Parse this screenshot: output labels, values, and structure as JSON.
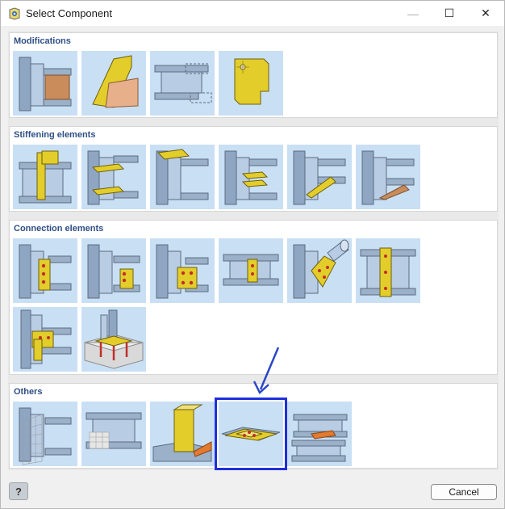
{
  "window": {
    "title": "Select Component",
    "minimize_glyph": "—",
    "maximize_glyph": "☐",
    "close_glyph": "✕"
  },
  "groups": [
    {
      "title": "Modifications",
      "items": [
        "modification-plate-cut",
        "modification-gusset-trim",
        "modification-member-cut",
        "modification-plate-notch"
      ]
    },
    {
      "title": "Stiffening elements",
      "items": [
        "stiffener-end-plate",
        "stiffener-flange-plates",
        "stiffener-web-plate",
        "stiffener-double-plates",
        "stiffener-diagonal",
        "stiffener-haunch"
      ]
    },
    {
      "title": "Connection elements",
      "items": [
        "connection-fin-plate",
        "connection-angle",
        "connection-end-plate-bolted",
        "connection-web-cleat",
        "connection-hollow-gusset",
        "connection-splice-plate",
        "connection-column-splice",
        "connection-base-plate"
      ]
    },
    {
      "title": "Others",
      "items": [
        "other-mesh-cut",
        "other-block-contact",
        "other-weld-plate",
        "other-plate-bolted",
        "other-beam-overlap"
      ],
      "selected_index": 3
    }
  ],
  "footer": {
    "help_glyph": "?",
    "cancel_label": "Cancel"
  },
  "colors": {
    "selection_border": "#1f2fdc",
    "group_title": "#2f4f86",
    "tile_background": "#c9dff4",
    "annotation_arrow": "#2a46c8"
  }
}
